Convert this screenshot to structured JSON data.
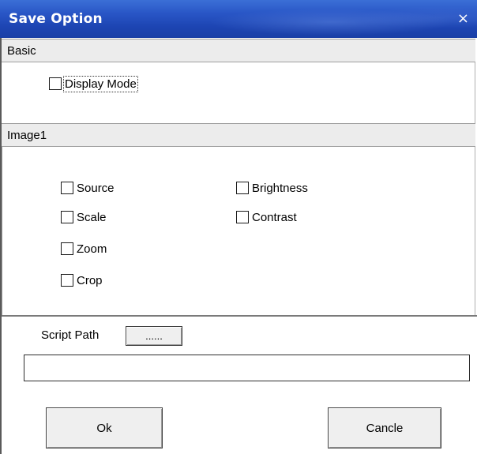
{
  "window": {
    "title": "Save Option",
    "close_glyph": "×"
  },
  "basic": {
    "header": "Basic",
    "display_mode_label": "Display Mode",
    "display_mode_checked": false
  },
  "image1": {
    "header": "Image1",
    "left_options": [
      {
        "label": "Source",
        "checked": false
      },
      {
        "label": "Scale",
        "checked": false
      },
      {
        "label": "Zoom",
        "checked": false
      },
      {
        "label": "Crop",
        "checked": false
      }
    ],
    "right_options": [
      {
        "label": "Brightness",
        "checked": false
      },
      {
        "label": "Contrast",
        "checked": false
      }
    ]
  },
  "script": {
    "label": "Script Path",
    "browse_label": "......",
    "path_value": ""
  },
  "actions": {
    "ok_label": "Ok",
    "cancel_label": "Cancle"
  },
  "colors": {
    "titlebar": "#2956c6",
    "section_header_bg": "#ececec"
  }
}
